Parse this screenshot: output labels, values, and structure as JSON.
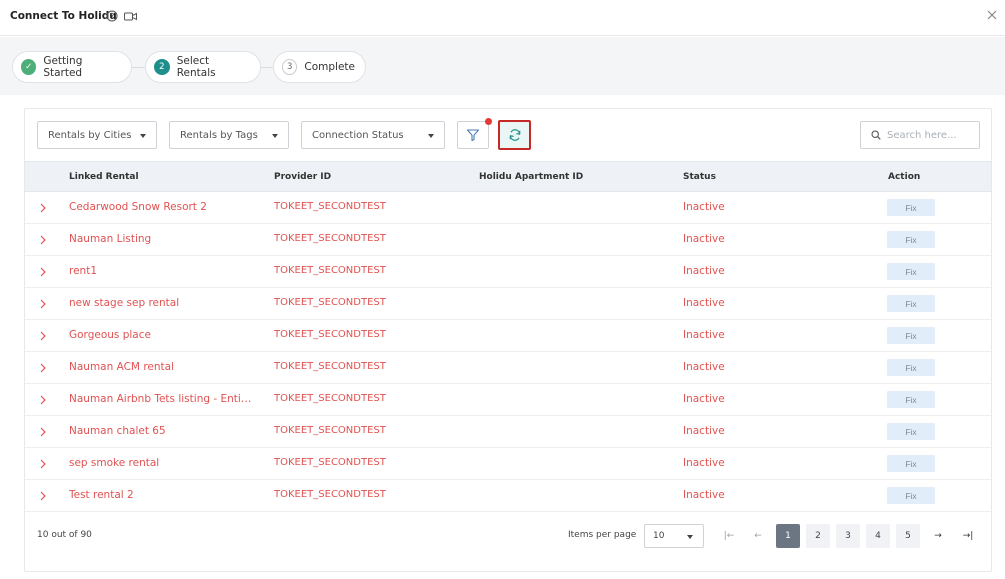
{
  "window": {
    "title": "Connect To Holidu"
  },
  "steps": [
    {
      "label": "Getting Started",
      "badge": "✓",
      "state": "done"
    },
    {
      "label": "Select Rentals",
      "badge": "2",
      "state": "active"
    },
    {
      "label": "Complete",
      "badge": "3",
      "state": "todo"
    }
  ],
  "filters": {
    "cities": "Rentals by Cities",
    "tags": "Rentals by Tags",
    "status": "Connection Status"
  },
  "search": {
    "placeholder": "Search here..."
  },
  "table": {
    "headers": {
      "linked_rental": "Linked Rental",
      "provider_id": "Provider ID",
      "holidu_id": "Holidu Apartment ID",
      "status": "Status",
      "action": "Action"
    },
    "rows": [
      {
        "name": "Cedarwood Snow Resort 2",
        "provider_id": "TOKEET_SECONDTEST",
        "holidu_id": "",
        "status": "Inactive",
        "action": "Fix"
      },
      {
        "name": "Nauman Listing",
        "provider_id": "TOKEET_SECONDTEST",
        "holidu_id": "",
        "status": "Inactive",
        "action": "Fix"
      },
      {
        "name": "rent1",
        "provider_id": "TOKEET_SECONDTEST",
        "holidu_id": "",
        "status": "Inactive",
        "action": "Fix"
      },
      {
        "name": "new stage sep rental",
        "provider_id": "TOKEET_SECONDTEST",
        "holidu_id": "",
        "status": "Inactive",
        "action": "Fix"
      },
      {
        "name": "Gorgeous place",
        "provider_id": "TOKEET_SECONDTEST",
        "holidu_id": "",
        "status": "Inactive",
        "action": "Fix"
      },
      {
        "name": "Nauman ACM rental",
        "provider_id": "TOKEET_SECONDTEST",
        "holidu_id": "",
        "status": "Inactive",
        "action": "Fix"
      },
      {
        "name": "Nauman Airbnb Tets listing - Entire home",
        "provider_id": "TOKEET_SECONDTEST",
        "holidu_id": "",
        "status": "Inactive",
        "action": "Fix"
      },
      {
        "name": "Nauman chalet 65",
        "provider_id": "TOKEET_SECONDTEST",
        "holidu_id": "",
        "status": "Inactive",
        "action": "Fix"
      },
      {
        "name": "sep smoke rental",
        "provider_id": "TOKEET_SECONDTEST",
        "holidu_id": "",
        "status": "Inactive",
        "action": "Fix"
      },
      {
        "name": "Test rental 2",
        "provider_id": "TOKEET_SECONDTEST",
        "holidu_id": "",
        "status": "Inactive",
        "action": "Fix"
      }
    ]
  },
  "pagination": {
    "count": "10 out of 90",
    "items_per_page_label": "Items per page",
    "items_per_page": "10",
    "pages": [
      "1",
      "2",
      "3",
      "4",
      "5"
    ],
    "current": "1",
    "first": "|←",
    "prev": "←",
    "next": "→",
    "last": "→|"
  },
  "colors": {
    "accent": "#1e8f8a",
    "inactive": "#e05252",
    "highlight": "#c62828"
  },
  "icons": {
    "help": "question-circle-icon",
    "video": "video-camera-icon",
    "close": "close-icon",
    "filter": "filter-icon",
    "refresh": "refresh-icon",
    "search": "search-icon",
    "row": "chevron-right-icon"
  }
}
